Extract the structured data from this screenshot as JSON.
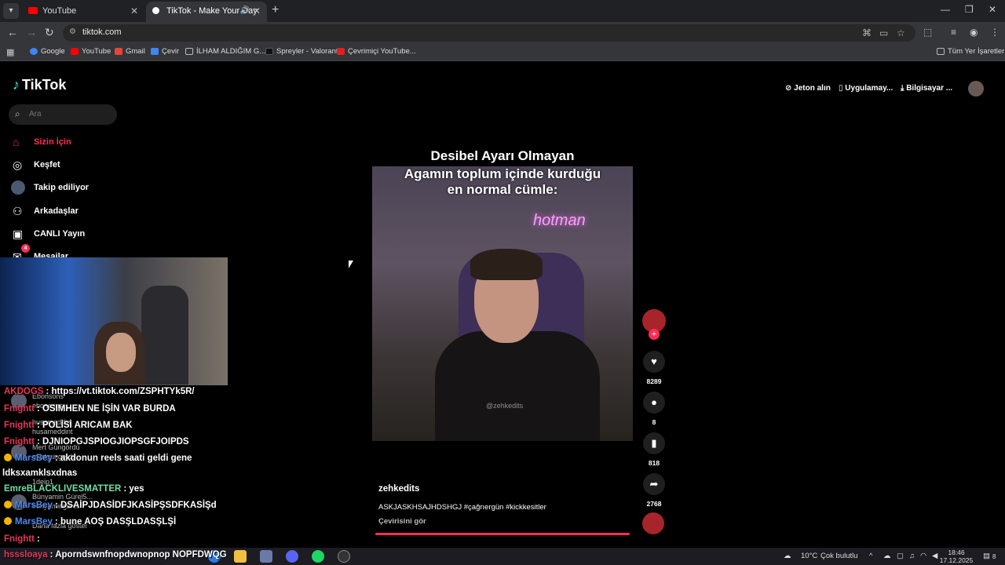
{
  "browser": {
    "tabs": [
      {
        "label": "YouTube",
        "active": false,
        "favicon_color": "#ff0000"
      },
      {
        "label": "TikTok - Make Your Day",
        "active": true,
        "favicon_color": "#ffffff"
      }
    ],
    "url": "tiktok.com",
    "bookmarks": [
      {
        "label": "Google",
        "icon_color": "#4285f4"
      },
      {
        "label": "YouTube",
        "icon_color": "#ff0000"
      },
      {
        "label": "Gmail",
        "icon_color": "#ea4335"
      },
      {
        "label": "Çevir",
        "icon_color": "#4285f4"
      },
      {
        "label": "İLHAM ALDIĞIM G...",
        "icon_color": "#888888"
      },
      {
        "label": "Spreyler - Valorant",
        "icon_color": "#111111"
      },
      {
        "label": "Çevrimiçi YouTube...",
        "icon_color": "#e02020"
      }
    ],
    "all_bookmarks_label": "Tüm Yer İşaretleri"
  },
  "tiktok": {
    "logo": "TikTok",
    "search_placeholder": "Ara",
    "nav": [
      {
        "label": "Sizin İçin",
        "icon": "home-icon",
        "active": true
      },
      {
        "label": "Keşfet",
        "icon": "compass-icon",
        "active": false
      },
      {
        "label": "Takip ediliyor",
        "icon": "following-icon",
        "active": false
      },
      {
        "label": "Arkadaşlar",
        "icon": "friends-icon",
        "active": false
      },
      {
        "label": "CANLI Yayın",
        "icon": "live-icon",
        "active": false
      },
      {
        "label": "Mesajlar",
        "icon": "messages-icon",
        "active": false,
        "badge": "4"
      }
    ],
    "top_actions": {
      "coins": "Jeton alın",
      "app": "Uygulamay...",
      "desktop": "Bilgisayar ..."
    },
    "video": {
      "caption_line1": "Desibel Ayarı Olmayan",
      "caption_line2": "Agamın toplum içinde kurduğu",
      "caption_line3": "en normal cümle:",
      "neon_text": "hotman",
      "watermark": "@zehkedits",
      "author": "zehkedits",
      "description": "ASKJASKHSAJHDSHGJ #çağrıergün #kickkesitler",
      "translate": "Çevirisini gör",
      "progress": 1.0,
      "likes": "8289",
      "comments": "8",
      "saves": "818",
      "shares": "2768"
    }
  },
  "chat": [
    {
      "user": "AKDOGS",
      "user_color": "#e8365c",
      "text": ": https://vt.tiktok.com/ZSPHTYk5R/",
      "badge": false
    },
    {
      "user": "Fnightt",
      "user_color": "#e8365c",
      "text": ": OSIMHEN NE İŞİN VAR BURDA",
      "badge": false
    },
    {
      "user": "Fnightt",
      "user_color": "#e8365c",
      "text": ": POLİSİ ARICAM BAK",
      "badge": false
    },
    {
      "user": "Fnightt",
      "user_color": "#e8365c",
      "text": ": DJNIOPGJSPIOGJIOPSGFJOIPDS",
      "badge": false
    },
    {
      "user": "MarsBey",
      "user_color": "#4d8af0",
      "text": ": akdonun reels saati geldi gene",
      "badge": true
    },
    {
      "user": "",
      "user_color": "#ffffff",
      "text": "ldksxamklsxdnas",
      "badge": false
    },
    {
      "user": "EmreBLACKLIVESMATTER",
      "user_color": "#6fe0a5",
      "text": ": yes",
      "badge": false
    },
    {
      "user": "MarsBey",
      "user_color": "#4d8af0",
      "text": ": DSAİPJDASİDFJKASİPŞSDFKASİŞd",
      "badge": true
    },
    {
      "user": "MarsBey",
      "user_color": "#4d8af0",
      "text": ": bune AOŞ DASŞLDASŞLŞİ",
      "badge": true
    },
    {
      "user": "Fnightt",
      "user_color": "#e8365c",
      "text": ":",
      "badge": false
    },
    {
      "user": "hsssloaya",
      "user_color": "#e8365c",
      "text": ": Aporndswnfnopdwnopnop NOPFDWQG",
      "badge": false
    }
  ],
  "following_list": [
    {
      "name": "Ebonsons",
      "handle": "ebonsons"
    },
    {
      "name": "husameddin",
      "handle": "husameddint"
    },
    {
      "name": "Mert Güngördü",
      "handle": "mertgungordu"
    },
    {
      "name": "1deip1",
      "handle": "1deip1"
    },
    {
      "name": "Bünyamin Gürel5...",
      "handle": "bunyamingurel"
    }
  ],
  "more_label": "Daha fazla göster",
  "taskbar": {
    "weather_temp": "10°C",
    "weather_text": "Çok bulutlu",
    "time": "18:46",
    "date": "17.12.2025",
    "notif_count": "8"
  }
}
